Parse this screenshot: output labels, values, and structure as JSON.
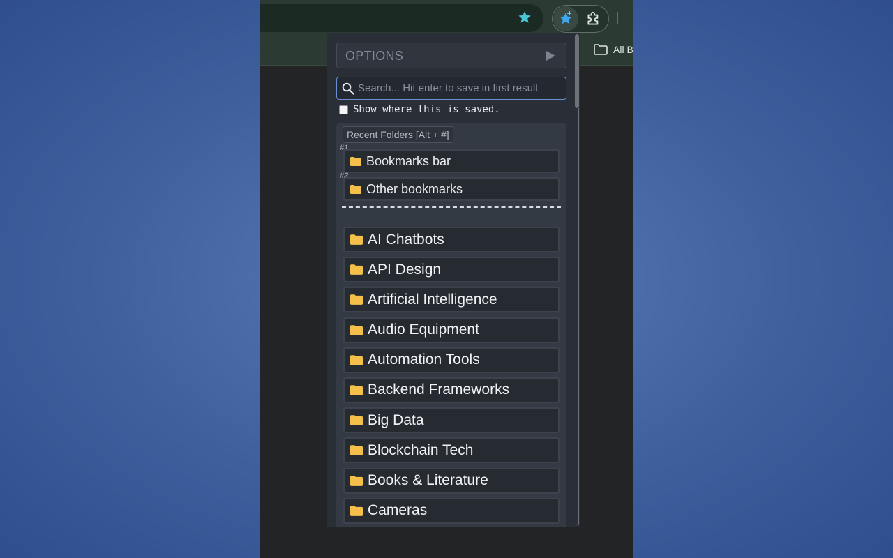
{
  "toolbar": {
    "bookmark_star": "star-icon",
    "extension_icon": "bookmark-extension-icon",
    "extensions_icon": "puzzle-icon"
  },
  "bookmarks_bar": {
    "all_bookmarks_label": "All B"
  },
  "popup": {
    "options_label": "OPTIONS",
    "options_arrow": "▶",
    "search": {
      "placeholder": "Search... Hit enter to save in first result",
      "value": ""
    },
    "show_saved_label": "Show where this is saved.",
    "recent": {
      "header": "Recent Folders [Alt + #]",
      "items": [
        {
          "num": "#1",
          "label": "Bookmarks bar"
        },
        {
          "num": "#2",
          "label": "Other bookmarks"
        }
      ]
    },
    "separator": "-----------------------------------------",
    "folders": [
      {
        "label": "AI Chatbots"
      },
      {
        "label": "API Design"
      },
      {
        "label": "Artificial Intelligence"
      },
      {
        "label": "Audio Equipment"
      },
      {
        "label": "Automation Tools"
      },
      {
        "label": "Backend Frameworks"
      },
      {
        "label": "Big Data"
      },
      {
        "label": "Blockchain Tech"
      },
      {
        "label": "Books & Literature"
      },
      {
        "label": "Cameras"
      }
    ]
  },
  "colors": {
    "background": "#3f5f9d",
    "folder_icon": "#f5c04a",
    "accent": "#4ac7d6"
  }
}
